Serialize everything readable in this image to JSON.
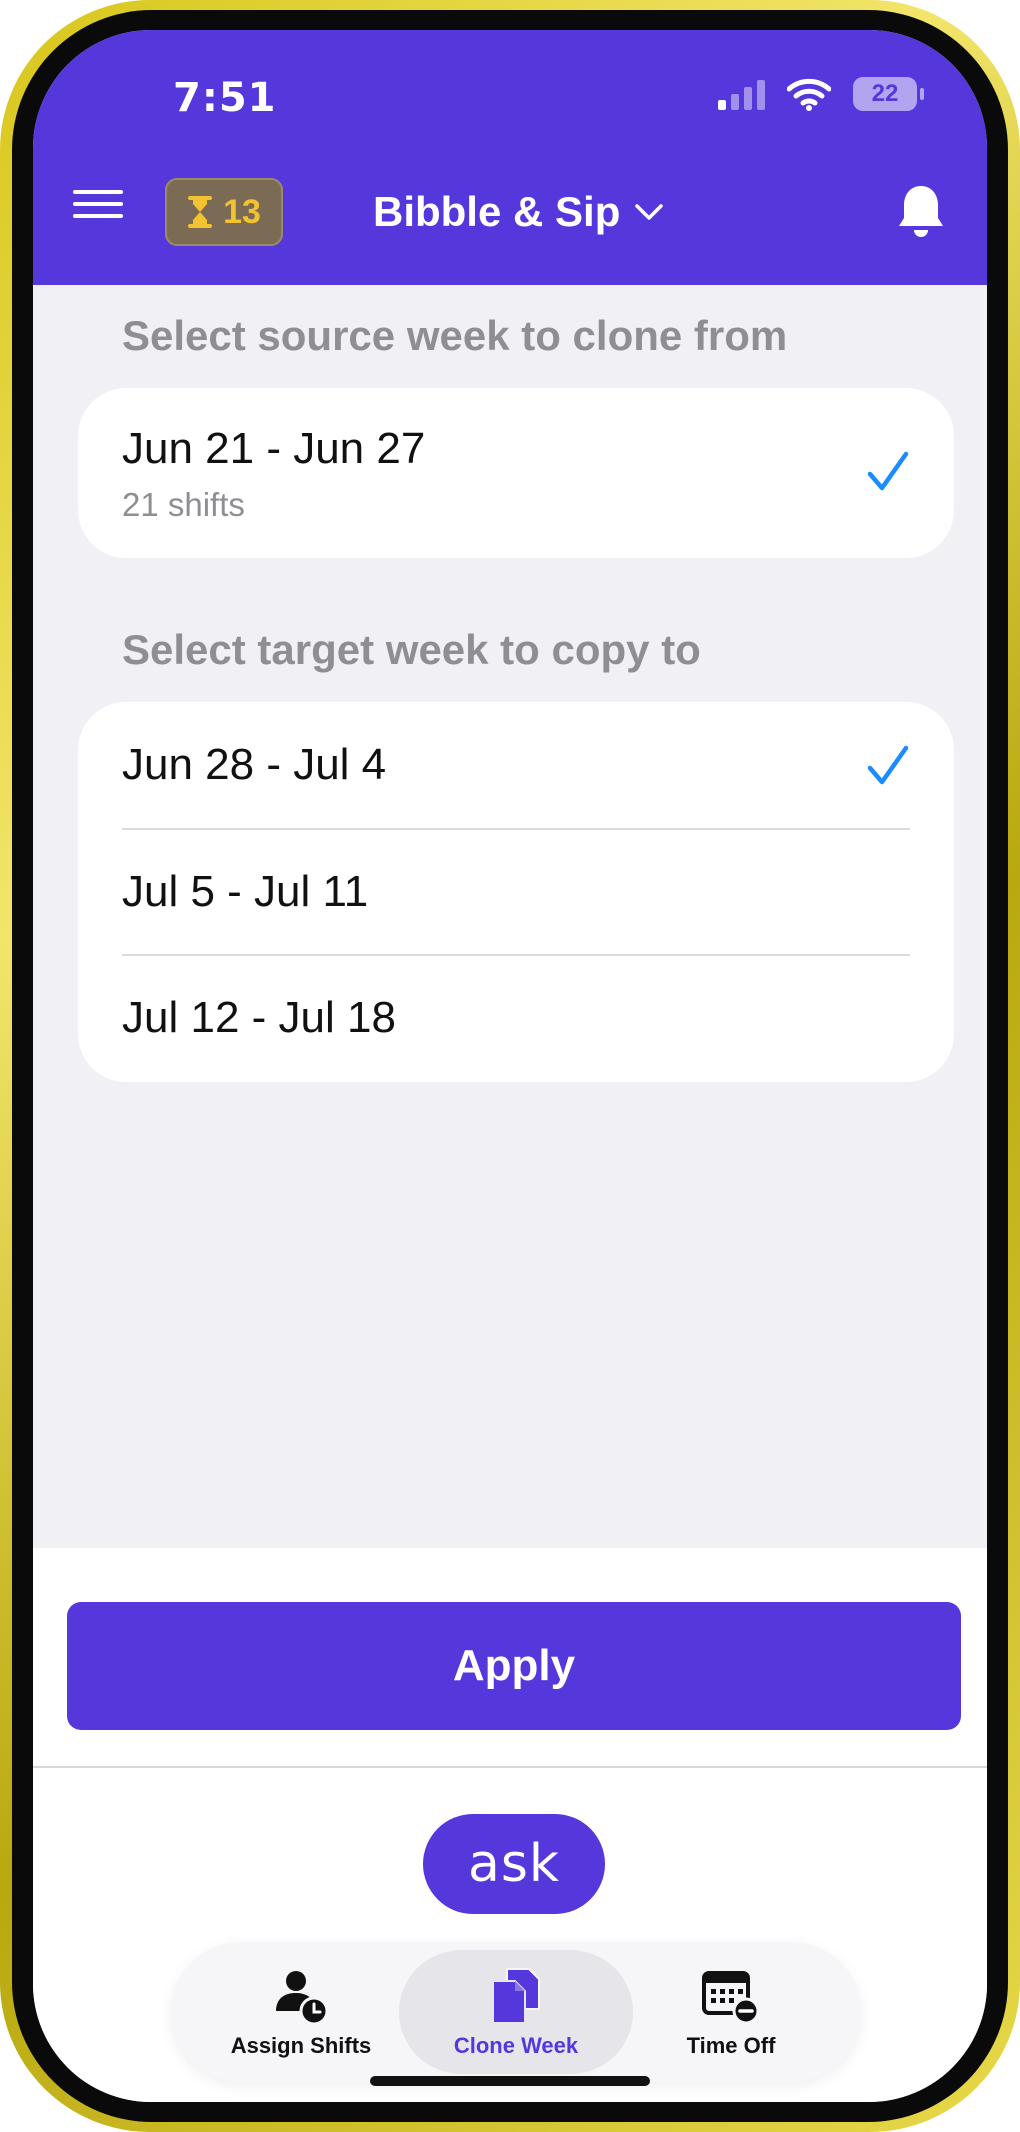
{
  "status_bar": {
    "time": "7:51",
    "battery": "22"
  },
  "header": {
    "timer_count": "13",
    "business_name": "Bibble & Sip"
  },
  "source_section": {
    "title": "Select source week to clone from",
    "weeks": [
      {
        "range": "Jun 21 - Jun 27",
        "shifts": "21 shifts",
        "selected": true
      }
    ]
  },
  "target_section": {
    "title": "Select target week to copy to",
    "weeks": [
      {
        "range": "Jun 28 - Jul 4",
        "selected": true
      },
      {
        "range": "Jul 5 - Jul 11",
        "selected": false
      },
      {
        "range": "Jul 12 - Jul 18",
        "selected": false
      }
    ]
  },
  "actions": {
    "apply_label": "Apply",
    "ask_label": "ask"
  },
  "tabbar": {
    "tabs": [
      {
        "label": "Assign Shifts",
        "icon": "assign-shifts-icon",
        "active": false
      },
      {
        "label": "Clone Week",
        "icon": "clone-week-icon",
        "active": true
      },
      {
        "label": "Time Off",
        "icon": "time-off-icon",
        "active": false
      }
    ]
  },
  "colors": {
    "brand": "#5537dc",
    "check": "#1a8cff",
    "frame": "#d8c61a",
    "timer_text": "#f2c230"
  }
}
